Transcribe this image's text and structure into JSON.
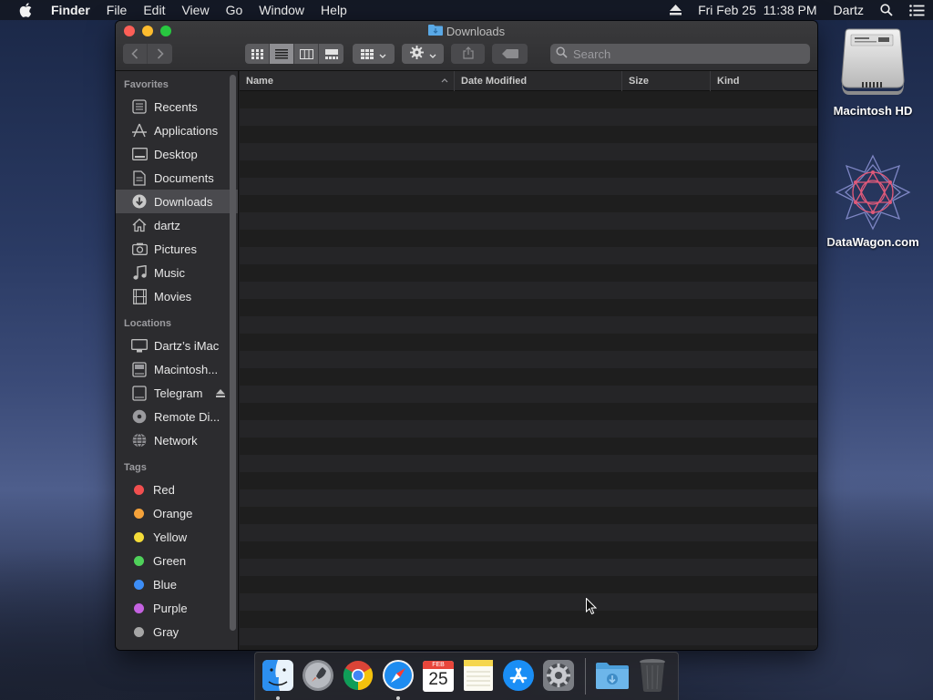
{
  "menubar": {
    "app_name": "Finder",
    "menus": [
      "File",
      "Edit",
      "View",
      "Go",
      "Window",
      "Help"
    ],
    "datetime": "Fri Feb 25  11:38 PM",
    "user": "Dartz"
  },
  "desktop": {
    "icons": [
      {
        "label": "Macintosh HD",
        "icon": "hard-drive-icon"
      },
      {
        "label": "DataWagon.com",
        "icon": "datawagon-logo-icon"
      }
    ]
  },
  "window": {
    "title": "Downloads",
    "search": {
      "placeholder": "Search",
      "value": ""
    },
    "view_mode": "list"
  },
  "sidebar": {
    "favorites_title": "Favorites",
    "favorites": [
      {
        "label": "Recents",
        "icon": "recents-icon"
      },
      {
        "label": "Applications",
        "icon": "applications-icon"
      },
      {
        "label": "Desktop",
        "icon": "desktop-icon"
      },
      {
        "label": "Documents",
        "icon": "documents-icon"
      },
      {
        "label": "Downloads",
        "icon": "downloads-icon",
        "selected": true
      },
      {
        "label": "dartz",
        "icon": "home-icon"
      },
      {
        "label": "Pictures",
        "icon": "pictures-icon"
      },
      {
        "label": "Music",
        "icon": "music-icon"
      },
      {
        "label": "Movies",
        "icon": "movies-icon"
      }
    ],
    "locations_title": "Locations",
    "locations": [
      {
        "label": "Dartz’s iMac",
        "icon": "computer-icon"
      },
      {
        "label": "Macintosh...",
        "icon": "disk-icon"
      },
      {
        "label": "Telegram",
        "icon": "disk-icon",
        "eject": true
      },
      {
        "label": "Remote Di...",
        "icon": "remote-disc-icon"
      },
      {
        "label": "Network",
        "icon": "network-icon"
      }
    ],
    "tags_title": "Tags",
    "tags": [
      {
        "label": "Red",
        "color": "#f14f4f"
      },
      {
        "label": "Orange",
        "color": "#f5a23a"
      },
      {
        "label": "Yellow",
        "color": "#f4dc39"
      },
      {
        "label": "Green",
        "color": "#4fd15a"
      },
      {
        "label": "Blue",
        "color": "#3d8ef7"
      },
      {
        "label": "Purple",
        "color": "#c462e0"
      },
      {
        "label": "Gray",
        "color": "#a6a6a6"
      }
    ]
  },
  "columns": {
    "name": "Name",
    "date_modified": "Date Modified",
    "size": "Size",
    "kind": "Kind"
  },
  "files": [],
  "dock": {
    "apps": [
      "finder-icon",
      "launchpad-icon",
      "chrome-icon",
      "safari-icon",
      "calendar-icon",
      "notes-icon",
      "app-store-icon",
      "system-preferences-icon",
      "downloads-folder-icon",
      "trash-icon"
    ],
    "calendar": {
      "month": "FEB",
      "day": "25"
    }
  }
}
